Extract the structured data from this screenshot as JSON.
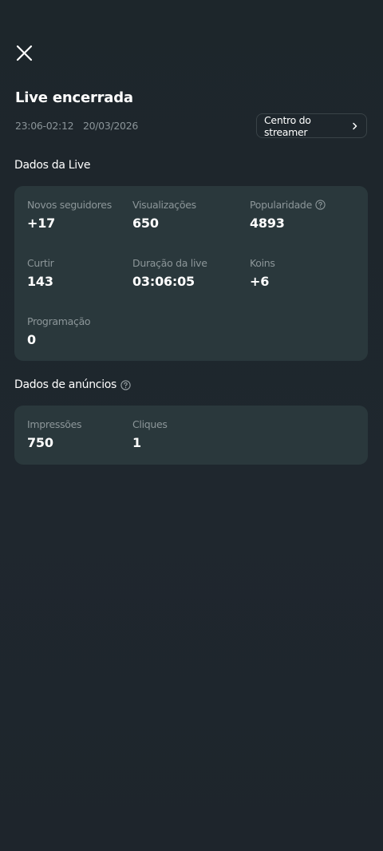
{
  "header": {
    "title": "Live encerrada",
    "time_range": "23:06-02:12",
    "date": "20/03/2026",
    "streamer_button_label": "Centro do streamer"
  },
  "live_data": {
    "section_title": "Dados da Live",
    "stats": [
      {
        "label": "Novos seguidores",
        "value": "+17"
      },
      {
        "label": "Visualizações",
        "value": "650"
      },
      {
        "label": "Popularidade",
        "value": "4893"
      },
      {
        "label": "Curtir",
        "value": "143"
      },
      {
        "label": "Duração da live",
        "value": "03:06:05"
      },
      {
        "label": "Koins",
        "value": "+6"
      },
      {
        "label": "Programação",
        "value": "0"
      }
    ]
  },
  "ads_data": {
    "section_title": "Dados de anúncios",
    "stats": [
      {
        "label": "Impressões",
        "value": "750"
      },
      {
        "label": "Cliques",
        "value": "1"
      }
    ]
  },
  "icons": {
    "close": "close-icon",
    "chevron": "chevron-right-icon",
    "help": "help-circle-icon"
  },
  "colors": {
    "background": "#1e262c",
    "card": "#2a383c",
    "muted_text": "#8c9699"
  }
}
